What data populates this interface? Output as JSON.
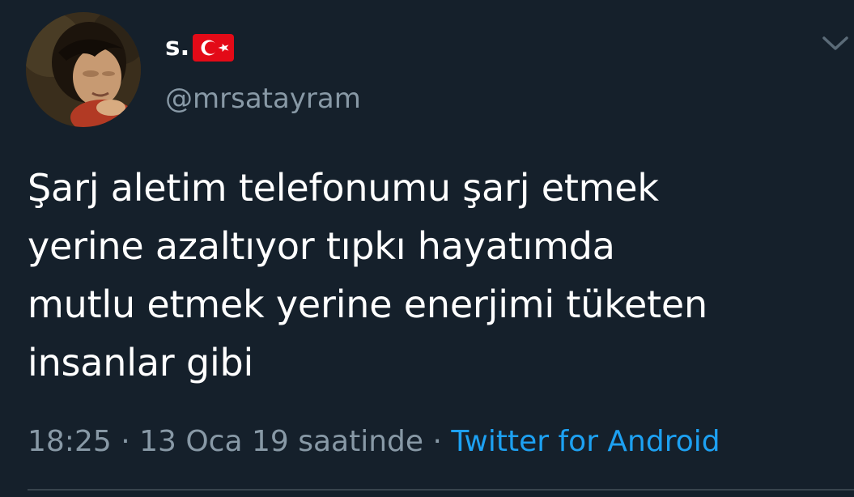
{
  "user": {
    "display_name": "s.",
    "handle": "@mrsatayram"
  },
  "tweet": {
    "text": "Şarj aletim telefonumu şarj etmek\nyerine azaltıyor tıpkı hayatımda\nmutlu etmek yerine enerjimi tüketen\ninsanlar gibi",
    "time": "18:25",
    "separator1": " · ",
    "date": "13 Oca 19 saatinde",
    "separator2": " · ",
    "source": "Twitter for Android"
  },
  "colors": {
    "background": "#15202b",
    "text": "#ffffff",
    "secondary_text": "#8899a6",
    "link": "#1da1f2",
    "flag_red": "#e30a17"
  },
  "icons": {
    "flag": "turkey-flag-icon",
    "menu": "chevron-down-icon"
  }
}
